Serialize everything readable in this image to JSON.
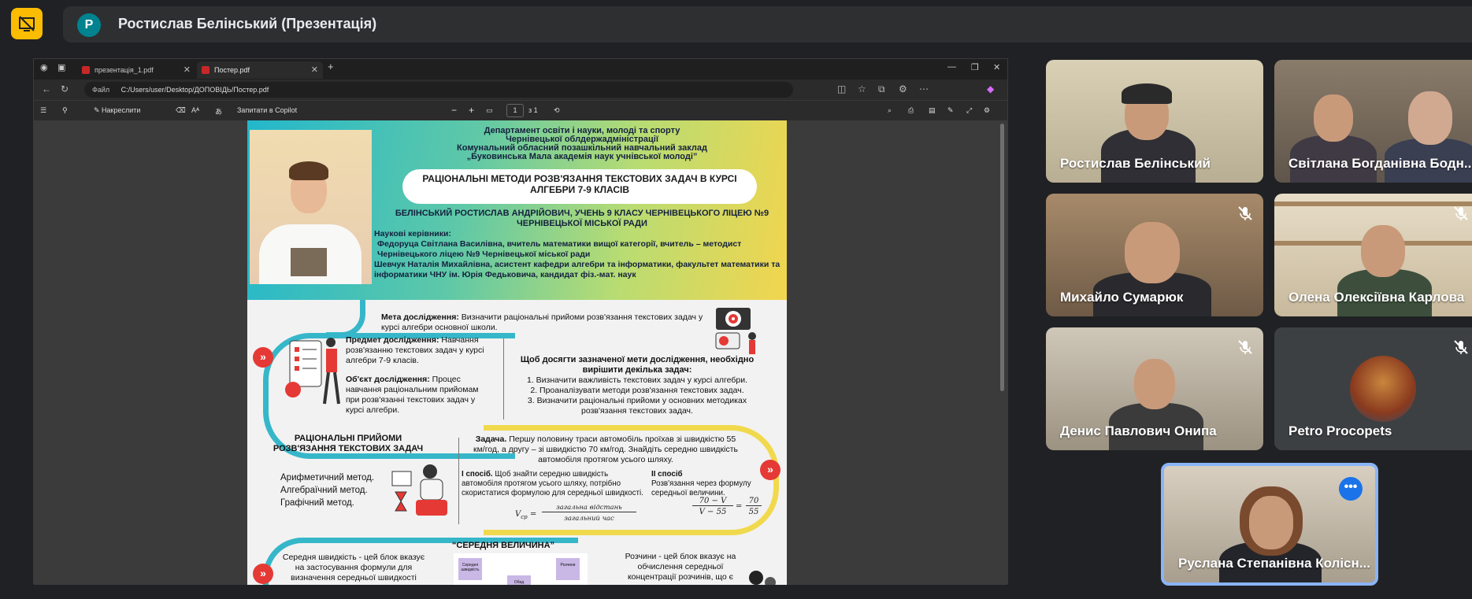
{
  "meeting": {
    "presenter_avatar_letter": "P",
    "presenter_title": "Ростислав Белінський (Презентація)",
    "present_icon": "stop-presenting-icon",
    "accent_color": "#fbbc04"
  },
  "browser": {
    "tabs": [
      {
        "label": "презентація_1.pdf",
        "active": false
      },
      {
        "label": "Постер.pdf",
        "active": true
      }
    ],
    "new_tab_label": "+",
    "address_prefix": "Файл",
    "address": "C:/Users/user/Desktop/ДОПОВІДЬ/Постер.pdf",
    "window_controls": [
      "—",
      "❐",
      "✕"
    ]
  },
  "pdf_toolbar": {
    "draw_label": "Накреслити",
    "copilot_label": "Запитати в Copilot",
    "zoom_out": "−",
    "zoom_in": "+",
    "page_current": "1",
    "page_total": "з 1"
  },
  "poster": {
    "institution": [
      "Департамент освіти і науки, молоді та спорту",
      "Чернівецької облдержадміністрації",
      "Комунальний обласний позашкільний навчальний заклад",
      "„Буковинська Мала академія наук учнівської молоді”"
    ],
    "title": "РАЦІОНАЛЬНІ МЕТОДИ РОЗВ'ЯЗАННЯ ТЕКСТОВИХ ЗАДАЧ В КУРСІ АЛГЕБРИ 7-9 КЛАСІВ",
    "author": "БЕЛІНСЬКИЙ РОСТИСЛАВ АНДРІЙОВИЧ, УЧЕНЬ 9 КЛАСУ ЧЕРНІВЕЦЬКОГО ЛІЦЕЮ №9 ЧЕРНІВЕЦЬКОЇ МІСЬКОЇ РАДИ",
    "supervisors_heading": "Наукові керівники:",
    "supervisor_1": "Федоруца Світлана Василівна, вчитель математики вищої категорії, вчитель – методист Чернівецького ліцею №9 Чернівецької міської ради",
    "supervisor_2": "Шевчук Наталія Михайлівна, асистент кафедри алгебри та інформатики, факультет математики та інформатики ЧНУ ім. Юрія Федьковича, кандидат фіз.-мат. наук",
    "goal_label": "Мета дослідження:",
    "goal_text": "Визначити раціональні прийоми розв'язання текстових задач у курсі алгебри основної школи.",
    "subject_label": "Предмет дослідження:",
    "subject_text": "Навчання розв'язанню текстових задач у курсі алгебри 7-9 класів.",
    "object_label": "Об'єкт дослідження:",
    "object_text": "Процес навчання раціональним прийомам при розв'язанні текстових задач у курсі алгебри.",
    "tasks_heading": "Щоб досягти зазначеної мети дослідження, необхідно вирішити декілька задач:",
    "tasks": [
      "1. Визначити важливість текстових задач у курсі алгебри.",
      "2. Проаналізувати методи розв'язання текстових задач.",
      "3. Визначити раціональні прийоми у основних методиках розв'язання текстових задач."
    ],
    "methods_heading": "РАЦІОНАЛЬНІ ПРИЙОМИ РОЗВ'ЯЗАННЯ ТЕКСТОВИХ ЗАДАЧ",
    "methods": [
      "Арифметичний метод.",
      "Алгебраїчний метод.",
      "Графічний метод."
    ],
    "task_label": "Задача.",
    "task_text": "Першу половину траси автомобіль проїхав зі швидкістю 55 км/год, а другу – зі швидкістю 70 км/год. Знайдіть середню швидкість автомобіля протягом усього шляху.",
    "way1_label": "І спосіб.",
    "way1_text": "Щоб знайти середню швидкість автомобіля протягом усього шляху, потрібно скористатися формулою для середньої швидкості.",
    "formula1_lhs": "V",
    "formula1_sub": "ср",
    "formula1_num": "загальна відстань",
    "formula1_den": "загальний час",
    "way2_label": "ІІ спосіб",
    "way2_text": "Розв'язання через формулу середньої величини.",
    "formula2_num_left": "70 − V",
    "formula2_den_left": "V",
    "formula2_den_left_tail": " − 55",
    "formula2_num_right": "70",
    "formula2_den_right": "55",
    "avg_heading": "“СЕРЕДНЯ ВЕЛИЧИНА”",
    "avg_left": "Середня швидкість - цей блок вказує на застосування формули для визначення середньої швидкості",
    "avg_right": "Розчини - цей блок вказує на обчислення середньої концентрації розчинів, що є",
    "diagram_box_1": "Середня швидкість",
    "diagram_box_2": "Розчини",
    "diagram_box_3": "Обид"
  },
  "participants": [
    {
      "name": "Ростислав Белінський",
      "muted": false
    },
    {
      "name": "Світлана Богданівна Бодн...",
      "muted": false
    },
    {
      "name": "Михайло Сумарюк",
      "muted": true
    },
    {
      "name": "Олена Олексіївна Карлова",
      "muted": true
    },
    {
      "name": "Денис Павлович Онипа",
      "muted": true
    },
    {
      "name": "Petro Procopets",
      "muted": true
    },
    {
      "name": "Руслана Степанівна Колісн...",
      "muted": false,
      "active_speaker": true
    }
  ],
  "more_options_icon": "more-options-icon",
  "more_options_glyph": "•••"
}
